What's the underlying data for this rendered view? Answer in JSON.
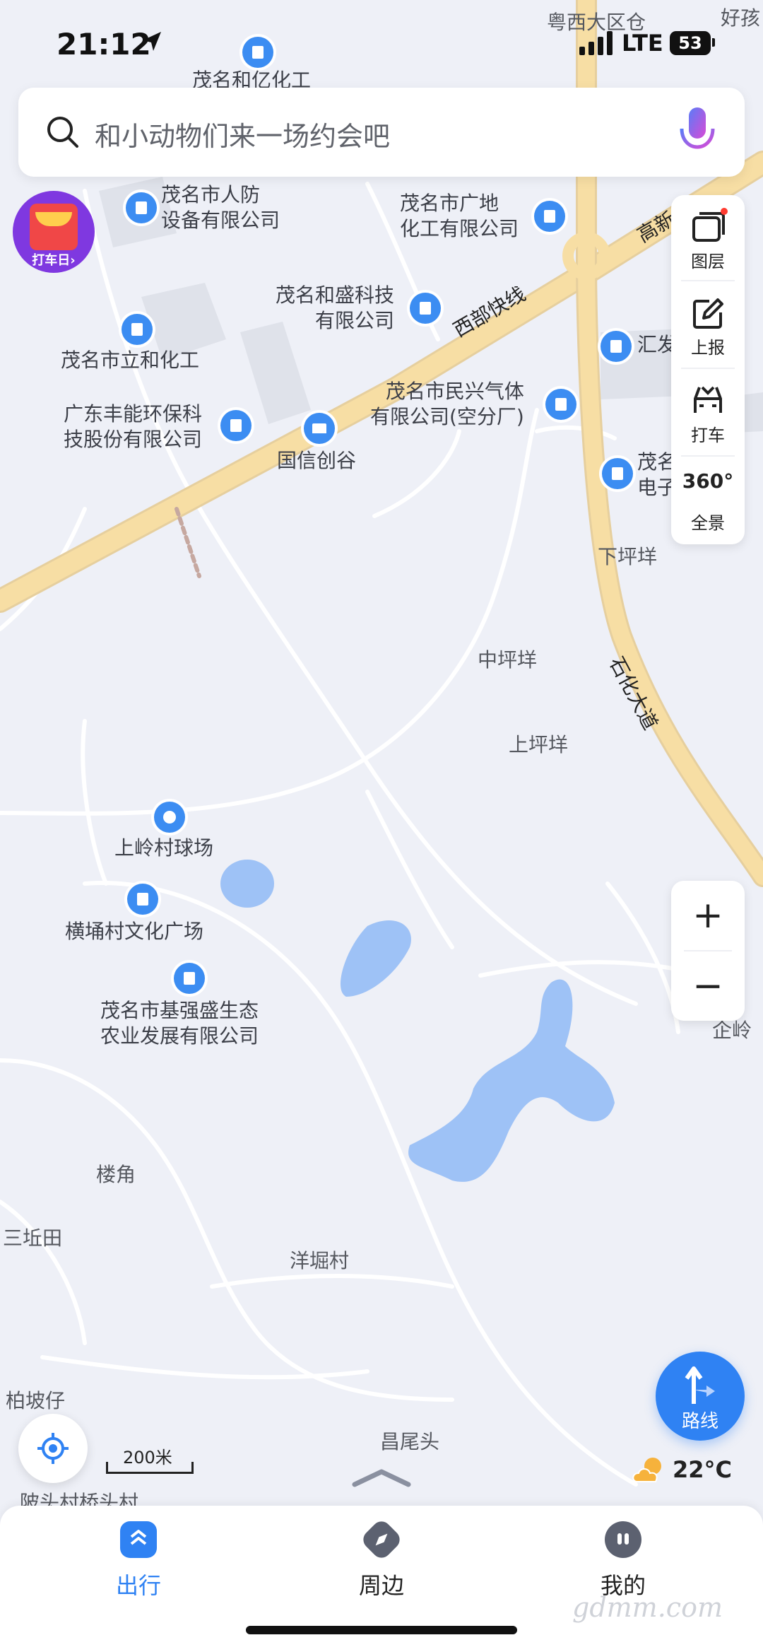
{
  "status_bar": {
    "time": "21:12",
    "network": "LTE",
    "battery": "53"
  },
  "search": {
    "placeholder": "和小动物们来一场约会吧"
  },
  "promo": {
    "label": "打车日›"
  },
  "toolbar": {
    "items": [
      {
        "label": "图层",
        "icon": "layers-icon"
      },
      {
        "label": "上报",
        "icon": "edit-report-icon"
      },
      {
        "label": "打车",
        "icon": "car-icon"
      },
      {
        "label": "全景",
        "icon": "panorama-360-icon",
        "badge": "360°"
      }
    ]
  },
  "map": {
    "pois": [
      {
        "label": "茂名和亿化工"
      },
      {
        "label": "茂名市人防\n设备有限公司"
      },
      {
        "label": "茂名市广地\n化工有限公司"
      },
      {
        "label": "茂名和盛科技\n有限公司"
      },
      {
        "label": "茂名市立和化工"
      },
      {
        "label": "广东丰能环保科\n技股份有限公司"
      },
      {
        "label": "国信创谷"
      },
      {
        "label": "茂名市民兴气体\n有限公司(空分厂)"
      },
      {
        "label": "汇发"
      },
      {
        "label": "茂名"
      },
      {
        "label": "电子"
      },
      {
        "label": "上岭村球场"
      },
      {
        "label": "横埇村文化广场"
      },
      {
        "label": "茂名市基强盛生态\n农业发展有限公司"
      }
    ],
    "places": [
      {
        "label": "粤西大区仓"
      },
      {
        "label": "好孩"
      },
      {
        "label": "下坪垟"
      },
      {
        "label": "中坪垟"
      },
      {
        "label": "上坪垟"
      },
      {
        "label": "楼角"
      },
      {
        "label": "三坵田"
      },
      {
        "label": "洋堀村"
      },
      {
        "label": "柏坡仔"
      },
      {
        "label": "昌尾头"
      },
      {
        "label": "陂头村桥头村"
      },
      {
        "label": "企岭"
      }
    ],
    "roads": [
      {
        "label": "西部快线"
      },
      {
        "label": "高新"
      },
      {
        "label": "石化大道"
      }
    ],
    "scale": "200米"
  },
  "zoom": {
    "in": "+",
    "out": "−"
  },
  "route": {
    "label": "路线"
  },
  "weather": {
    "temp": "22°C",
    "icon": "cloudy-sun-icon"
  },
  "bottom_nav": {
    "items": [
      {
        "label": "出行",
        "icon": "travel-icon",
        "active": true
      },
      {
        "label": "周边",
        "icon": "compass-icon",
        "active": false
      },
      {
        "label": "我的",
        "icon": "profile-icon",
        "active": false
      }
    ]
  },
  "watermark": "gdmm.com",
  "colors": {
    "accent": "#2f82f3",
    "map_bg": "#eef0f7",
    "road": "#f5d899",
    "water": "#9ec2f6",
    "poi": "#3c8df2"
  }
}
